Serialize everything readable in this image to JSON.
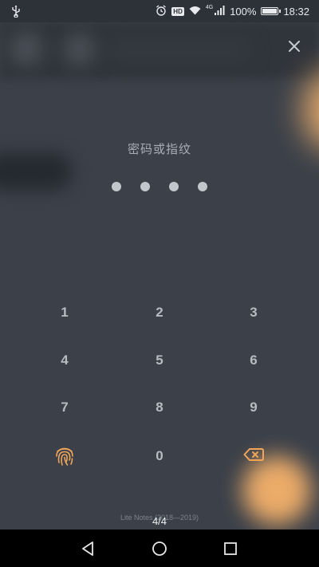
{
  "status_bar": {
    "network": "4G",
    "hd_badge": "HD",
    "battery_percent": "100%",
    "battery_level": 1.0,
    "time": "18:32",
    "icons": [
      "usb-icon",
      "alarm-icon",
      "hd-icon",
      "wifi-icon",
      "signal-icon",
      "battery-icon"
    ]
  },
  "lock_screen": {
    "prompt": "密码或指纹",
    "pin_length": 4,
    "close_icon": "close-icon"
  },
  "keypad": {
    "keys": [
      "1",
      "2",
      "3",
      "4",
      "5",
      "6",
      "7",
      "8",
      "9",
      "0"
    ],
    "fingerprint_icon": "fingerprint-icon",
    "backspace_icon": "backspace-icon"
  },
  "footer": {
    "credit": "Lite Notes (2018—2019)",
    "page_counter": "4/4"
  },
  "nav_bar": {
    "icons": [
      "back-icon",
      "home-icon",
      "recents-icon"
    ]
  },
  "colors": {
    "background": "#3b4049",
    "accent": "#f0a55a",
    "text": "#b7bbc2"
  }
}
